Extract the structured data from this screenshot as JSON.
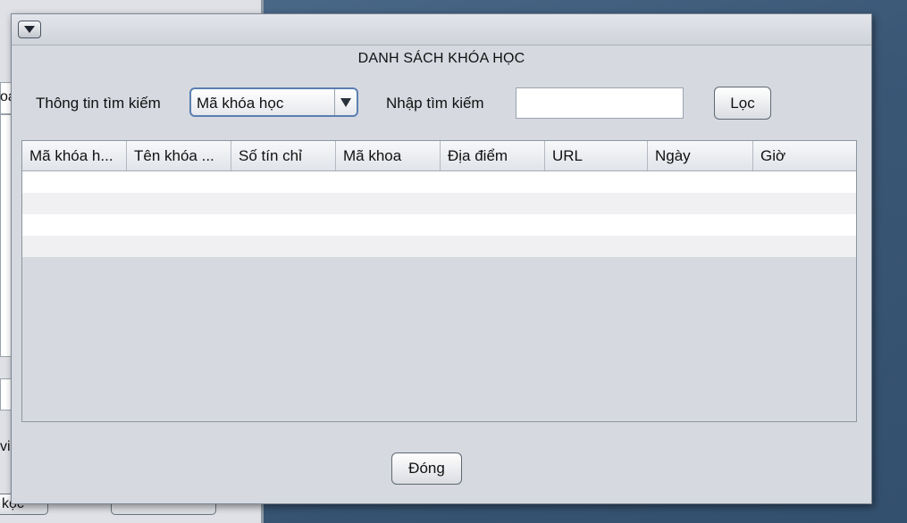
{
  "background_window": {
    "fragments": [
      "oa",
      "vi",
      "kọc"
    ]
  },
  "dialog": {
    "heading": "DANH SÁCH KHÓA HỌC",
    "search_info_label": "Thông tin tìm kiếm",
    "search_field_select": {
      "selected": "Mã khóa học"
    },
    "search_input_label": "Nhập tìm kiếm",
    "search_input_value": "",
    "filter_button": "Lọc",
    "close_button": "Đóng",
    "table": {
      "columns": [
        "Mã khóa h...",
        "Tên khóa ...",
        "Số tín chỉ",
        "Mã khoa",
        "Địa điểm",
        "URL",
        "Ngày",
        "Giờ"
      ],
      "rows": []
    }
  },
  "colors": {
    "dialog_bg": "#d6d9e0",
    "combo_border": "#5b7fb0",
    "desktop": "#3d5a78"
  }
}
